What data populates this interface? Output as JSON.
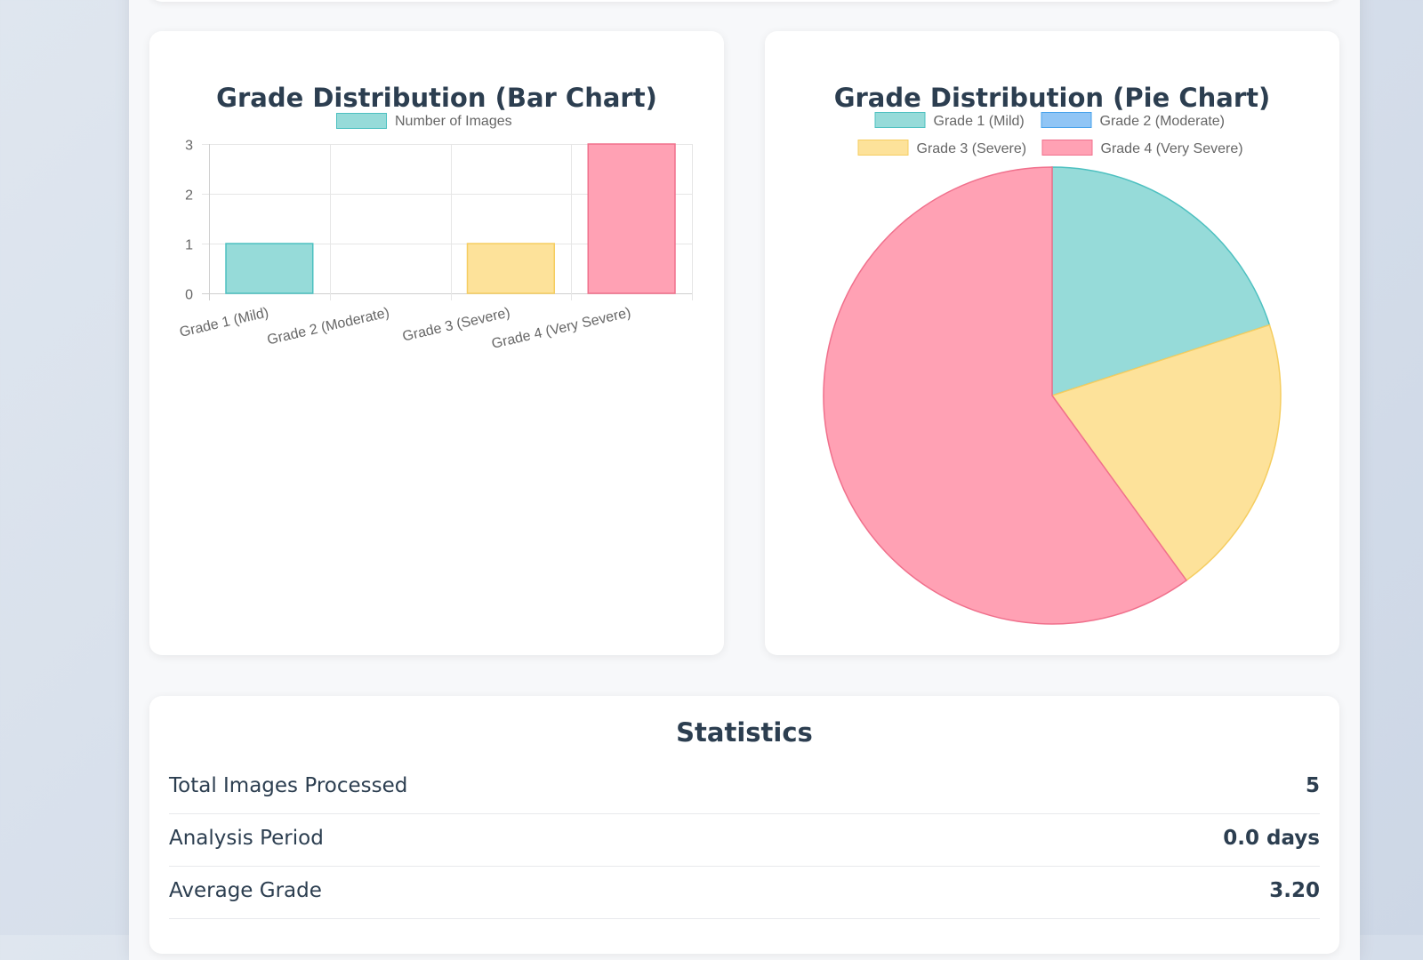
{
  "bar_card": {
    "title": "Grade Distribution (Bar Chart)"
  },
  "pie_card": {
    "title": "Grade Distribution (Pie Chart)"
  },
  "chart_data": [
    {
      "type": "bar",
      "title": "Grade Distribution (Bar Chart)",
      "categories": [
        "Grade 1 (Mild)",
        "Grade 2 (Moderate)",
        "Grade 3 (Severe)",
        "Grade 4 (Very Severe)"
      ],
      "series": [
        {
          "name": "Number of Images",
          "values": [
            1,
            0,
            1,
            3
          ]
        }
      ],
      "colors": {
        "fill": [
          "#96dbd9",
          "#90c5f5",
          "#fde29a",
          "#ffa1b4"
        ],
        "stroke": [
          "#4dc0c0",
          "#46a2eb",
          "#f5cd60",
          "#f0708c"
        ],
        "legend_fill": "#96dbd9",
        "legend_stroke": "#4dc0c0"
      },
      "ylim": [
        0,
        3
      ],
      "yticks": [
        0,
        1,
        2,
        3
      ],
      "grid": true,
      "legend_position": "top",
      "xlabel": "",
      "ylabel": ""
    },
    {
      "type": "pie",
      "title": "Grade Distribution (Pie Chart)",
      "labels": [
        "Grade 1 (Mild)",
        "Grade 2 (Moderate)",
        "Grade 3 (Severe)",
        "Grade 4 (Very Severe)"
      ],
      "values": [
        1,
        0,
        1,
        3
      ],
      "colors": {
        "fill": [
          "#96dbd9",
          "#90c5f5",
          "#fde29a",
          "#ffa1b4"
        ],
        "stroke": [
          "#4dc0c0",
          "#46a2eb",
          "#f5cd60",
          "#f0708c"
        ]
      },
      "legend_position": "top"
    }
  ],
  "statistics": {
    "title": "Statistics",
    "rows": [
      {
        "label": "Total Images Processed",
        "value": "5"
      },
      {
        "label": "Analysis Period",
        "value": "0.0 days"
      },
      {
        "label": "Average Grade",
        "value": "3.20"
      }
    ]
  }
}
